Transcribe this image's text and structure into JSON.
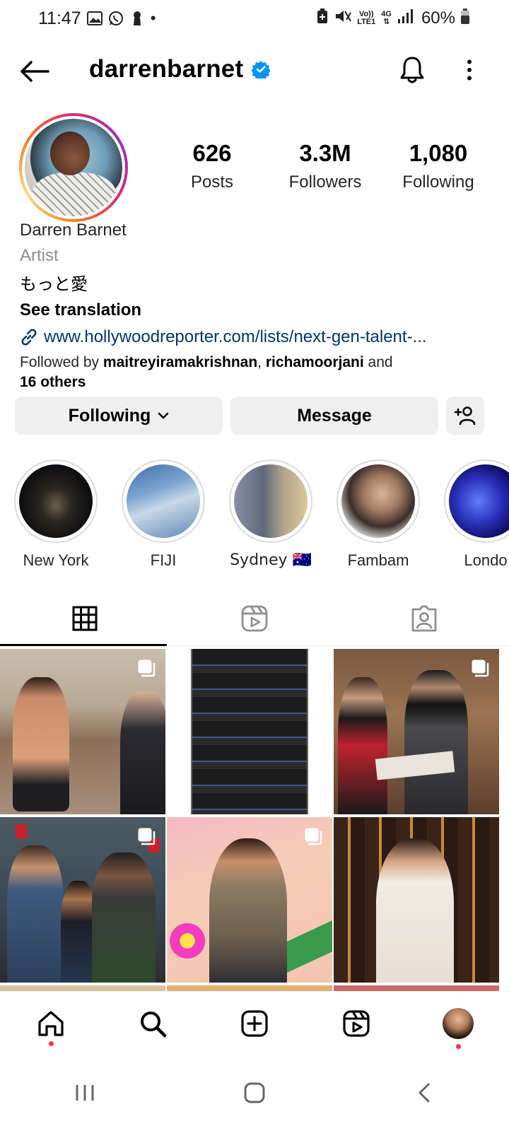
{
  "status_bar": {
    "time": "11:47",
    "battery": "60%",
    "network_vo": "Vo))",
    "network_lte": "LTE1",
    "network_4g": "4G"
  },
  "header": {
    "username": "darrenbarnet",
    "verified": true
  },
  "profile": {
    "stats": [
      {
        "value": "626",
        "label": "Posts"
      },
      {
        "value": "3.3M",
        "label": "Followers"
      },
      {
        "value": "1,080",
        "label": "Following"
      }
    ],
    "full_name": "Darren Barnet",
    "category": "Artist",
    "bio": "もっと愛",
    "see_translation": "See translation",
    "link": "www.hollywoodreporter.com/lists/next-gen-talent-...",
    "followed_by_prefix": "Followed by ",
    "followed_by_user1": "maitreyiramakrishnan",
    "followed_by_sep": ", ",
    "followed_by_user2": "richamoorjani",
    "followed_by_and": " and",
    "followed_by_others": "16 others"
  },
  "actions": {
    "following_label": "Following",
    "message_label": "Message"
  },
  "highlights": [
    {
      "label": "New York"
    },
    {
      "label": "FIJI"
    },
    {
      "label": "Sydney 🇦🇺"
    },
    {
      "label": "Fambam"
    },
    {
      "label": "Londo"
    }
  ],
  "colors": {
    "link": "#00376b",
    "verified": "#0095f6",
    "notification_dot": "#ff3040",
    "button_bg": "#efefef"
  }
}
